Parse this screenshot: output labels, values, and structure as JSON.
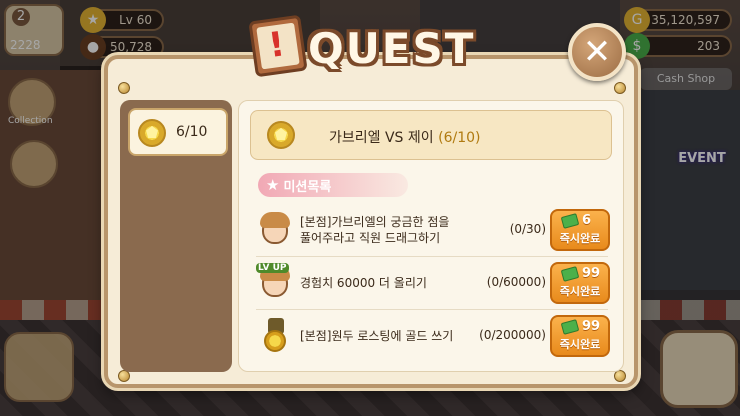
{
  "hud": {
    "level_badge_number": "2",
    "level_badge_value": "2228",
    "level": "Lv 60",
    "beans": "50,728",
    "gold": "35,120,597",
    "cash": "203",
    "cash_shop_label": "Cash Shop",
    "collection_label": "Collection",
    "event_label": "EVENT"
  },
  "dialog": {
    "title": "QUEST",
    "close_label": "✕",
    "left_tab_count": "6/10",
    "header_title": "가브리엘 VS 제이",
    "header_progress": "(6/10)",
    "section_label": "미션목록",
    "missions": [
      {
        "desc_line1": "[본점]가브리엘의 궁금한 점을",
        "desc_line2": "풀어주라고 직원 드래그하기",
        "progress": "(0/30)",
        "reward": "6",
        "button_label": "즉시완료"
      },
      {
        "desc_line1": "경험치 60000 더 올리기",
        "desc_line2": "",
        "progress": "(0/60000)",
        "reward": "99",
        "button_label": "즉시완료"
      },
      {
        "desc_line1": "[본점]원두 로스팅에 골드 쓰기",
        "desc_line2": "",
        "progress": "(0/200000)",
        "reward": "99",
        "button_label": "즉시완료"
      }
    ]
  },
  "colors": {
    "dialog_bg": "#f6ecd7",
    "frame": "#b8956b",
    "button_orange": "#f0a030",
    "progress_gold": "#b07a10"
  }
}
